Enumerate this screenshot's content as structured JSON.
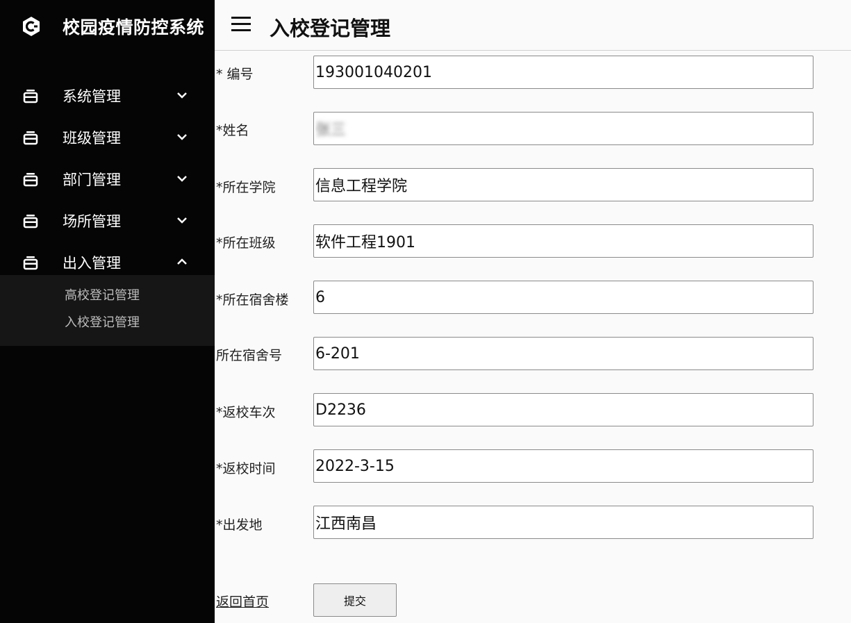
{
  "sidebar": {
    "app_title": "校园疫情防控系统",
    "logo_icon": "c-logo-icon",
    "nav_items": [
      {
        "label": "系统管理",
        "icon": "stack-icon",
        "expanded": false
      },
      {
        "label": "班级管理",
        "icon": "stack-icon",
        "expanded": false
      },
      {
        "label": "部门管理",
        "icon": "stack-icon",
        "expanded": false
      },
      {
        "label": "场所管理",
        "icon": "stack-icon",
        "expanded": false
      },
      {
        "label": "出入管理",
        "icon": "stack-icon",
        "expanded": true
      }
    ],
    "sub_items": [
      {
        "label": "高校登记管理"
      },
      {
        "label": "入校登记管理"
      }
    ]
  },
  "header": {
    "menu_icon": "hamburger-icon",
    "title": "入校登记管理"
  },
  "form": {
    "fields": [
      {
        "label": "* 编号",
        "value": "193001040201"
      },
      {
        "label": "*姓名",
        "value": "张三"
      },
      {
        "label": "*所在学院",
        "value": "信息工程学院"
      },
      {
        "label": "*所在班级",
        "value": "软件工程1901"
      },
      {
        "label": "*所在宿舍楼",
        "value": "6"
      },
      {
        "label": "所在宿舍号",
        "value": "6-201"
      },
      {
        "label": "*返校车次",
        "value": "D2236"
      },
      {
        "label": "*返校时间",
        "value": "2022-3-15"
      },
      {
        "label": "*出发地",
        "value": "江西南昌"
      }
    ],
    "back_link": "返回首页",
    "submit_label": "提交"
  },
  "colors": {
    "sidebar_bg": "#050505",
    "submenu_bg": "#161616",
    "page_bg": "#fafafa"
  }
}
